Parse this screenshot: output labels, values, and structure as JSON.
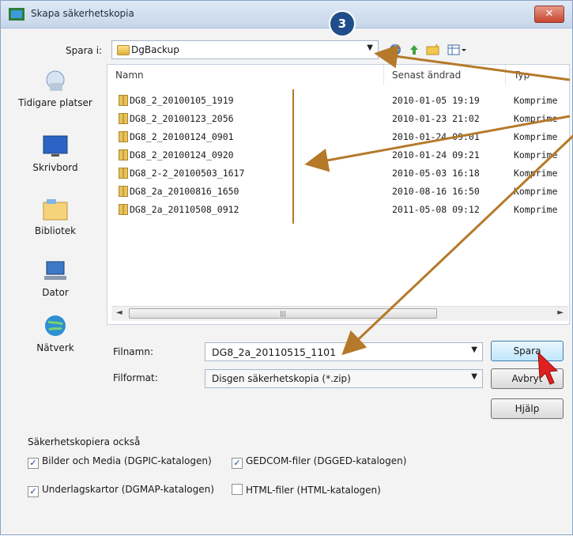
{
  "window": {
    "title": "Skapa säkerhetskopia",
    "close_label": "✕",
    "step_badge": "3"
  },
  "save_in": {
    "label": "Spara i:",
    "value": "DgBackup"
  },
  "toolbar": {
    "icons": [
      "back-globe-icon",
      "up-folder-icon",
      "new-folder-icon",
      "view-menu-icon"
    ]
  },
  "places": [
    {
      "name": "tidigare-platser",
      "label": "Tidigare platser"
    },
    {
      "name": "skrivbord",
      "label": "Skrivbord"
    },
    {
      "name": "bibliotek",
      "label": "Bibliotek"
    },
    {
      "name": "dator",
      "label": "Dator"
    },
    {
      "name": "natverk",
      "label": "Nätverk"
    }
  ],
  "columns": {
    "name": "Namn",
    "date": "Senast ändrad",
    "type": "Typ"
  },
  "files": [
    {
      "name": "DG8_2_20100105_1919",
      "date": "2010-01-05 19:19",
      "type": "Komprime"
    },
    {
      "name": "DG8_2_20100123_2056",
      "date": "2010-01-23 21:02",
      "type": "Komprime"
    },
    {
      "name": "DG8_2_20100124_0901",
      "date": "2010-01-24 09:01",
      "type": "Komprime"
    },
    {
      "name": "DG8_2_20100124_0920",
      "date": "2010-01-24 09:21",
      "type": "Komprime"
    },
    {
      "name": "DG8_2-2_20100503_1617",
      "date": "2010-05-03 16:18",
      "type": "Komprime"
    },
    {
      "name": "DG8_2a_20100816_1650",
      "date": "2010-08-16 16:50",
      "type": "Komprime"
    },
    {
      "name": "DG8_2a_20110508_0912",
      "date": "2011-05-08 09:12",
      "type": "Komprime"
    }
  ],
  "filename": {
    "label": "Filnamn:",
    "value": "DG8_2a_20110515_1101"
  },
  "fileformat": {
    "label": "Filformat:",
    "value": "Disgen säkerhetskopia (*.zip)"
  },
  "buttons": {
    "save": "Spara",
    "cancel": "Avbryt",
    "help": "Hjälp"
  },
  "also_backup": {
    "heading": "Säkerhetskopiera också",
    "options": [
      {
        "label": "Bilder och Media (DGPIC-katalogen)",
        "checked": true
      },
      {
        "label": "GEDCOM-filer (DGGED-katalogen)",
        "checked": true
      },
      {
        "label": "Underlagskartor (DGMAP-katalogen)",
        "checked": true
      },
      {
        "label": "HTML-filer (HTML-katalogen)",
        "checked": false
      }
    ]
  },
  "colors": {
    "annotation_arrow": "#b5792a",
    "badge": "#1f4e8a"
  }
}
